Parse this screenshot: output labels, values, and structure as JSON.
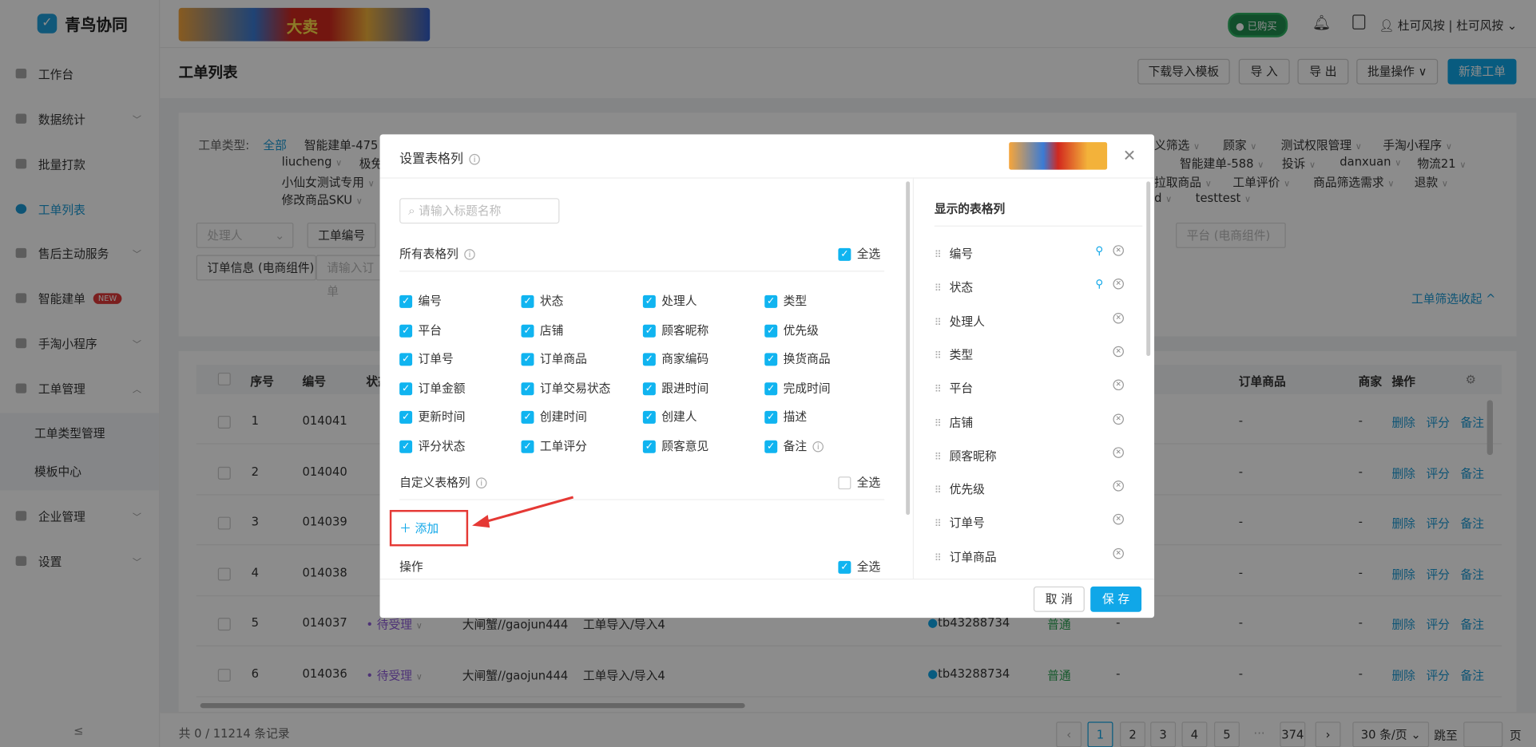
{
  "app": {
    "name": "青鸟协同",
    "banner_text": "大卖",
    "bought": "已购买",
    "user": "杜可风按 | 杜可风按"
  },
  "sidebar": {
    "items": [
      {
        "label": "工作台",
        "chev": false
      },
      {
        "label": "数据统计",
        "chev": true
      },
      {
        "label": "批量打款",
        "chev": false
      },
      {
        "label": "工单列表",
        "chev": false,
        "active": true
      },
      {
        "label": "售后主动服务",
        "chev": true
      },
      {
        "label": "智能建单",
        "badge": "NEW"
      },
      {
        "label": "手淘小程序",
        "chev": true
      },
      {
        "label": "工单管理",
        "chev": "up"
      }
    ],
    "sub": [
      "工单类型管理",
      "模板中心"
    ],
    "bottom": [
      {
        "label": "企业管理"
      },
      {
        "label": "设置"
      }
    ],
    "collapse": "≤"
  },
  "page": {
    "title": "工单列表",
    "buttons": {
      "download": "下载导入模板",
      "import": "导 入",
      "export": "导 出",
      "batch": "批量操作 ∨",
      "create": "新建工单"
    }
  },
  "filter": {
    "type_label": "工单类型:",
    "all": "全部",
    "types_row1": [
      "智能建单-475",
      "义筛选",
      "顾家",
      "测试权限管理",
      "手淘小程序"
    ],
    "types_row2": [
      "liucheng",
      "极免",
      "智能建单-588",
      "投诉",
      "danxuan",
      "物流21"
    ],
    "types_row3": [
      "小仙女测试专用",
      "拉取商品",
      "工单评价",
      "商品筛选需求",
      "退款"
    ],
    "types_row4": [
      "修改商品SKU",
      "d",
      "testtest"
    ],
    "handler_placeholder": "处理人",
    "ticket_no": "工单编号",
    "platform": "平台 (电商组件)",
    "order_info": "订单信息 (电商组件)",
    "order_placeholder": "请输入订单",
    "collapse": "工单筛选收起 ^"
  },
  "table": {
    "headers": [
      "序号",
      "编号",
      "状态",
      "订单商品",
      "商家",
      "操作"
    ],
    "rows": [
      {
        "no": "1",
        "id": "014041"
      },
      {
        "no": "2",
        "id": "014040"
      },
      {
        "no": "3",
        "id": "014039"
      },
      {
        "no": "4",
        "id": "014038"
      },
      {
        "no": "5",
        "id": "014037",
        "status": "待受理",
        "customer": "大闸蟹//gaojun444",
        "type": "工单导入/导入4",
        "shop": "tb43288734",
        "priority": "普通"
      },
      {
        "no": "6",
        "id": "014036",
        "status": "待受理",
        "customer": "大闸蟹//gaojun444",
        "type": "工单导入/导入4",
        "shop": "tb43288734",
        "priority": "普通"
      }
    ],
    "dash": "-",
    "actions": [
      "删除",
      "评分",
      "备注"
    ]
  },
  "pagination": {
    "total": "共 0 / 11214 条记录",
    "pages": [
      "1",
      "2",
      "3",
      "4",
      "5",
      "···",
      "374"
    ],
    "current": "1",
    "page_size": "30 条/页",
    "jump": "跳至",
    "page_unit": "页"
  },
  "modal": {
    "title": "设置表格列",
    "search_placeholder": "请输入标题名称",
    "all_section": "所有表格列",
    "select_all": "全选",
    "all_columns": [
      "编号",
      "状态",
      "处理人",
      "类型",
      "平台",
      "店铺",
      "顾客昵称",
      "优先级",
      "订单号",
      "订单商品",
      "商家编码",
      "换货商品",
      "订单金额",
      "订单交易状态",
      "跟进时间",
      "完成时间",
      "更新时间",
      "创建时间",
      "创建人",
      "描述",
      "评分状态",
      "工单评分",
      "顾客意见",
      "备注"
    ],
    "custom_section": "自定义表格列",
    "add": "添加",
    "ops_section": "操作",
    "shown_title": "显示的表格列",
    "shown": [
      "编号",
      "状态",
      "处理人",
      "类型",
      "平台",
      "店铺",
      "顾客昵称",
      "优先级",
      "订单号",
      "订单商品"
    ],
    "cancel": "取 消",
    "save": "保 存"
  },
  "colors": {
    "accent": "#10a7e8",
    "link": "#1a9ad6",
    "annotation": "#e53935",
    "status": "#8e5cd9",
    "priority": "#27a04f"
  }
}
